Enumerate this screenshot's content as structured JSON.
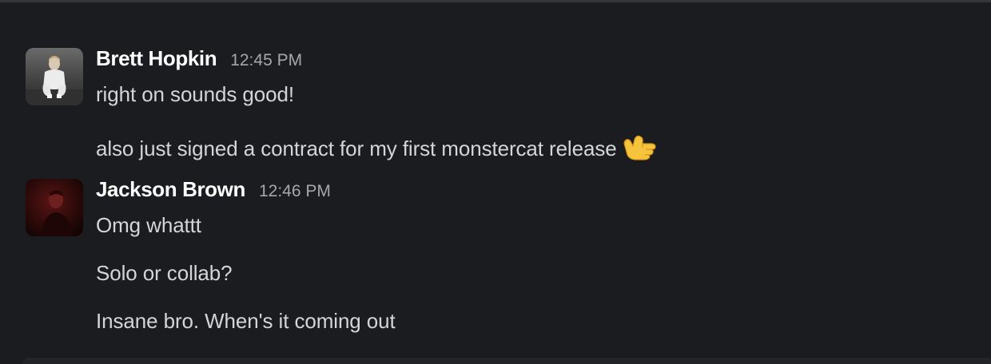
{
  "messages": [
    {
      "sender": "Brett Hopkin",
      "time": "12:45 PM",
      "avatar_icon": "user-photo-white-hoodie",
      "lines": [
        "right on sounds good!",
        "also just signed a contract for my first monstercat release"
      ],
      "emoji": "call-me-hand-emoji"
    },
    {
      "sender": "Jackson Brown",
      "time": "12:46 PM",
      "avatar_icon": "user-photo-red-dark",
      "lines": [
        "Omg whattt",
        "Solo or collab?",
        "Insane bro. When's it coming out"
      ]
    }
  ],
  "colors": {
    "background": "#1b1c1f",
    "sender_name": "#ffffff",
    "message_text": "#d4d5d6",
    "timestamp": "#a6a7aa"
  }
}
